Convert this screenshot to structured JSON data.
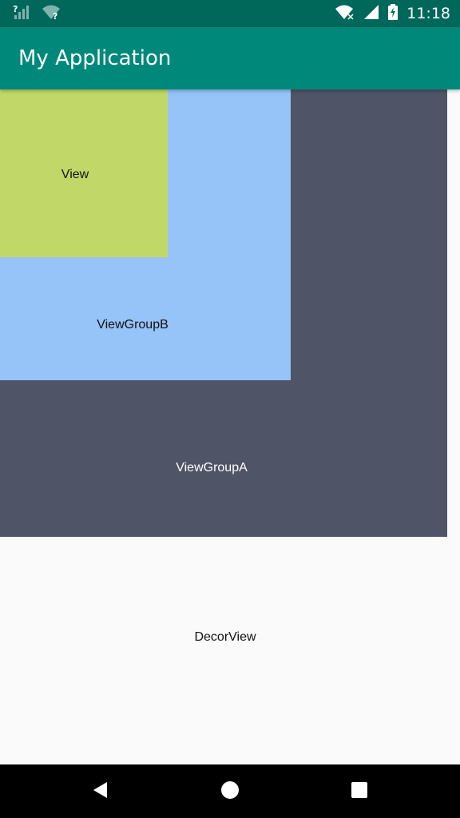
{
  "status_bar": {
    "time": "11:18",
    "icons": [
      "signal-unknown-icon",
      "wifi-unknown-icon",
      "wifi-icon",
      "cell-signal-icon",
      "battery-charging-icon"
    ]
  },
  "app_bar": {
    "title": "My Application",
    "color": "#00897b"
  },
  "layout": {
    "decor_view_label": "DecorView",
    "view_group_a_label": "ViewGroupA",
    "view_group_b_label": "ViewGroupB",
    "view_label": "View",
    "colors": {
      "decor_view": "#fafafa",
      "view_group_a": "#4f5467",
      "view_group_b": "#96c3f8",
      "view": "#c1d868"
    }
  },
  "nav_bar": {
    "icons": [
      "back-icon",
      "home-icon",
      "recents-icon"
    ]
  }
}
